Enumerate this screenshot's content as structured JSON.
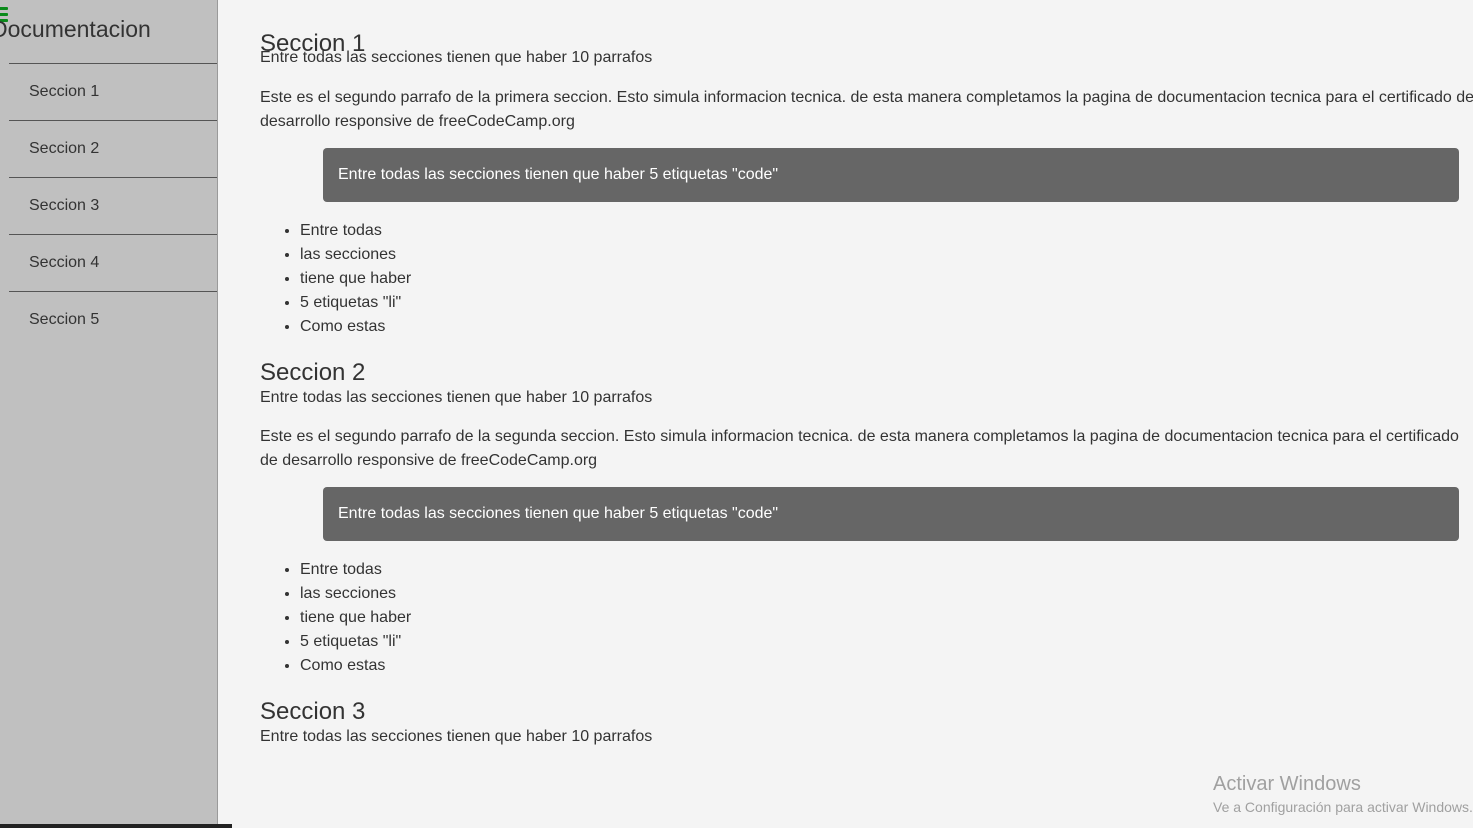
{
  "navbar": {
    "title": "Documentacion",
    "links": [
      "Seccion 1",
      "Seccion 2",
      "Seccion 3",
      "Seccion 4",
      "Seccion 5"
    ]
  },
  "sections": [
    {
      "title": "Seccion 1",
      "p1": "Entre todas las secciones tienen que haber 10 parrafos",
      "p2": "Este es el segundo parrafo de la primera seccion. Esto simula informacion tecnica. de esta manera completamos la pagina de documentacion tecnica para el certificado de desarrollo responsive de freeCodeCamp.org",
      "code": "Entre todas las secciones tienen que haber 5 etiquetas \"code\"",
      "items": [
        "Entre todas",
        "las secciones",
        "tiene que haber",
        "5 etiquetas \"li\"",
        "Como estas"
      ]
    },
    {
      "title": "Seccion 2",
      "p1": "Entre todas las secciones tienen que haber 10 parrafos",
      "p2": "Este es el segundo parrafo de la segunda seccion. Esto simula informacion tecnica. de esta manera completamos la pagina de documentacion tecnica para el certificado de desarrollo responsive de freeCodeCamp.org",
      "code": "Entre todas las secciones tienen que haber 5 etiquetas \"code\"",
      "items": [
        "Entre todas",
        "las secciones",
        "tiene que haber",
        "5 etiquetas \"li\"",
        "Como estas"
      ]
    },
    {
      "title": "Seccion 3",
      "p1": "Entre todas las secciones tienen que haber 10 parrafos"
    }
  ],
  "watermark": {
    "line1": "Activar Windows",
    "line2": "Ve a Configuración para activar Windows."
  },
  "colors": {
    "sidebar": "#c0c0c0",
    "background": "#f4f4f4",
    "code_block": "#666666",
    "hamburger": "#0a8a1a"
  }
}
